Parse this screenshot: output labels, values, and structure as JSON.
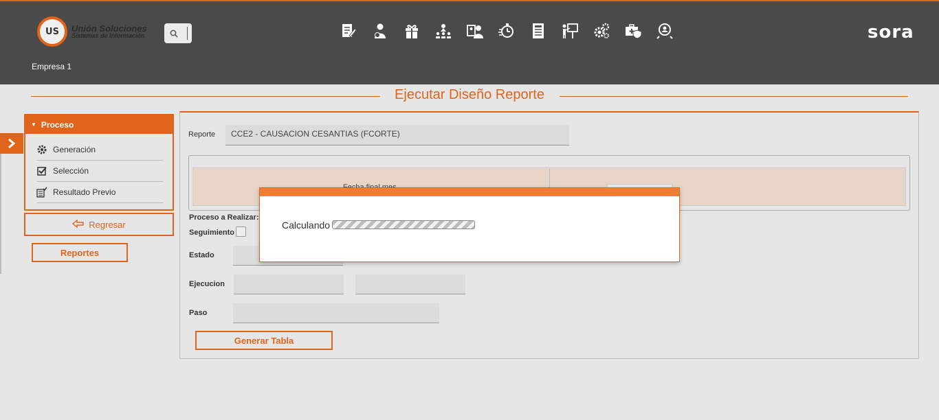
{
  "header": {
    "logo_initials": "US",
    "logo_title": "Unión Soluciones",
    "logo_subtitle": "Sistemas de Información",
    "brand": "sora",
    "company": "Empresa 1",
    "nav_icons": [
      "edit-document-icon",
      "user-money-icon",
      "gift-icon",
      "org-chart-icon",
      "user-id-icon",
      "stopwatch-icon",
      "report-list-icon",
      "presenter-board-icon",
      "settings-gears-icon",
      "medical-case-shield-icon",
      "user-search-icon"
    ]
  },
  "page": {
    "title": "Ejecutar Diseño Reporte"
  },
  "sidebar": {
    "section_title": "Proceso",
    "items": [
      {
        "label": "Generación",
        "icon": "gear-icon"
      },
      {
        "label": "Selección",
        "icon": "checkbox-check-icon"
      },
      {
        "label": "Resultado Previo",
        "icon": "list-check-icon"
      }
    ],
    "regresar_label": "Regresar",
    "reportes_label": "Reportes"
  },
  "form": {
    "reporte_label": "Reporte",
    "reporte_value": "CCE2 - CAUSACION CESANTIAS (FCORTE)",
    "fecha_label": "Fecha final mes",
    "proceso_label": "Proceso a Realizar:",
    "seguimiento_label": "Seguimiento",
    "estado_label": "Estado",
    "ejecucion_label": "Ejecucion",
    "paso_label": "Paso",
    "generar_label": "Generar Tabla"
  },
  "modal": {
    "text": "Calculando"
  },
  "colors": {
    "accent": "#e0641a",
    "header_bg": "#4a4a4a",
    "page_bg": "#e6e6e6"
  }
}
